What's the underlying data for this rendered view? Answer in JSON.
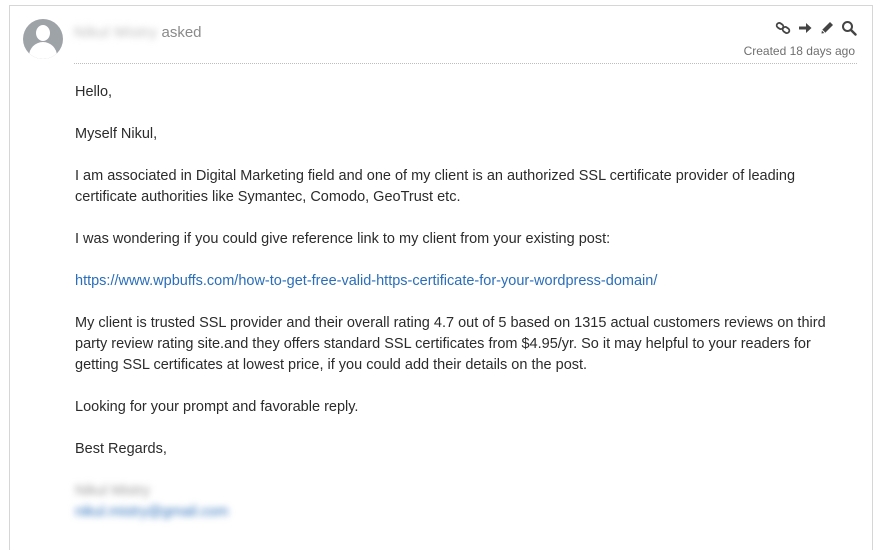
{
  "post": {
    "author_name": "Nikul Mistry",
    "action": "asked",
    "created": "Created 18 days ago",
    "tools": [
      {
        "name": "link-icon"
      },
      {
        "name": "arrow-right-icon"
      },
      {
        "name": "pencil-icon"
      },
      {
        "name": "search-icon"
      }
    ],
    "paragraphs": [
      "Hello,",
      "Myself Nikul,",
      "I am associated in Digital Marketing field and one of my client is an authorized SSL certificate provider of leading certificate authorities like Symantec, Comodo, GeoTrust etc.",
      "I was wondering if you could give reference link to my client from your existing post:"
    ],
    "link": "https://www.wpbuffs.com/how-to-get-free-valid-https-certificate-for-your-wordpress-domain/",
    "paragraphs_after": [
      "My client is trusted SSL provider and their overall rating 4.7 out of 5 based on 1315 actual customers reviews on third party review rating site.and they offers standard SSL certificates from $4.95/yr. So it may helpful to your readers for getting SSL certificates at lowest price, if you could add their details on the post.",
      "Looking for your prompt and favorable reply.",
      "Best Regards,"
    ],
    "signature": {
      "name": "Nikul Mistry",
      "email": "nikul.mistry@gmail.com"
    }
  },
  "colors": {
    "link": "#2a6ebb",
    "muted": "#8a8a8a",
    "avatar": "#9ea3a8"
  }
}
